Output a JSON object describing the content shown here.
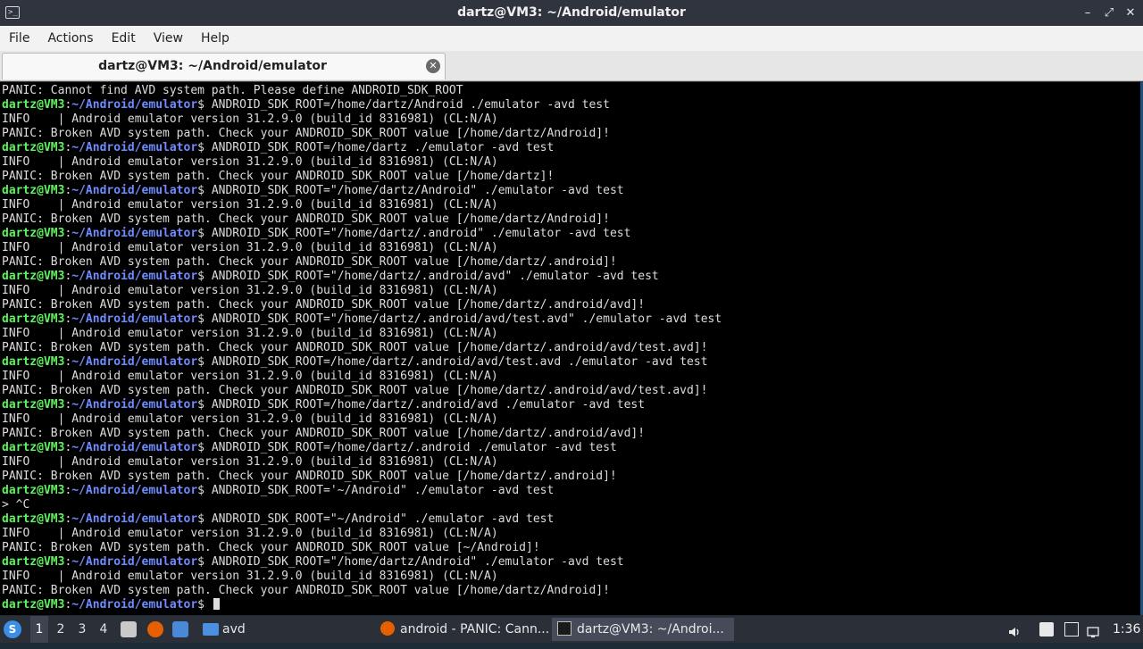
{
  "window": {
    "title": "dartz@VM3: ~/Android/emulator",
    "app_icon_text": ">_",
    "buttons": {
      "minimize": "–",
      "maximize": "⤢",
      "close": "✕"
    }
  },
  "menu": [
    "File",
    "Actions",
    "Edit",
    "View",
    "Help"
  ],
  "tab": {
    "label": "dartz@VM3: ~/Android/emulator",
    "close_glyph": "✕"
  },
  "prompt": {
    "user": "dartz@VM3",
    "path": "~/Android/emulator"
  },
  "terminal_lines": [
    {
      "type": "out",
      "text": "PANIC: Cannot find AVD system path. Please define ANDROID_SDK_ROOT"
    },
    {
      "type": "cmd",
      "text": "ANDROID_SDK_ROOT=/home/dartz/Android ./emulator -avd test"
    },
    {
      "type": "out",
      "text": "INFO    | Android emulator version 31.2.9.0 (build_id 8316981) (CL:N/A)"
    },
    {
      "type": "out",
      "text": "PANIC: Broken AVD system path. Check your ANDROID_SDK_ROOT value [/home/dartz/Android]!"
    },
    {
      "type": "cmd",
      "text": "ANDROID_SDK_ROOT=/home/dartz ./emulator -avd test"
    },
    {
      "type": "out",
      "text": "INFO    | Android emulator version 31.2.9.0 (build_id 8316981) (CL:N/A)"
    },
    {
      "type": "out",
      "text": "PANIC: Broken AVD system path. Check your ANDROID_SDK_ROOT value [/home/dartz]!"
    },
    {
      "type": "cmd",
      "text": "ANDROID_SDK_ROOT=\"/home/dartz/Android\" ./emulator -avd test"
    },
    {
      "type": "out",
      "text": "INFO    | Android emulator version 31.2.9.0 (build_id 8316981) (CL:N/A)"
    },
    {
      "type": "out",
      "text": "PANIC: Broken AVD system path. Check your ANDROID_SDK_ROOT value [/home/dartz/Android]!"
    },
    {
      "type": "cmd",
      "text": "ANDROID_SDK_ROOT=\"/home/dartz/.android\" ./emulator -avd test"
    },
    {
      "type": "out",
      "text": "INFO    | Android emulator version 31.2.9.0 (build_id 8316981) (CL:N/A)"
    },
    {
      "type": "out",
      "text": "PANIC: Broken AVD system path. Check your ANDROID_SDK_ROOT value [/home/dartz/.android]!"
    },
    {
      "type": "cmd",
      "text": "ANDROID_SDK_ROOT=\"/home/dartz/.android/avd\" ./emulator -avd test"
    },
    {
      "type": "out",
      "text": "INFO    | Android emulator version 31.2.9.0 (build_id 8316981) (CL:N/A)"
    },
    {
      "type": "out",
      "text": "PANIC: Broken AVD system path. Check your ANDROID_SDK_ROOT value [/home/dartz/.android/avd]!"
    },
    {
      "type": "cmd",
      "text": "ANDROID_SDK_ROOT=\"/home/dartz/.android/avd/test.avd\" ./emulator -avd test"
    },
    {
      "type": "out",
      "text": "INFO    | Android emulator version 31.2.9.0 (build_id 8316981) (CL:N/A)"
    },
    {
      "type": "out",
      "text": "PANIC: Broken AVD system path. Check your ANDROID_SDK_ROOT value [/home/dartz/.android/avd/test.avd]!"
    },
    {
      "type": "cmd",
      "text": "ANDROID_SDK_ROOT=/home/dartz/.android/avd/test.avd ./emulator -avd test"
    },
    {
      "type": "out",
      "text": "INFO    | Android emulator version 31.2.9.0 (build_id 8316981) (CL:N/A)"
    },
    {
      "type": "out",
      "text": "PANIC: Broken AVD system path. Check your ANDROID_SDK_ROOT value [/home/dartz/.android/avd/test.avd]!"
    },
    {
      "type": "cmd",
      "text": "ANDROID_SDK_ROOT=/home/dartz/.android/avd ./emulator -avd test"
    },
    {
      "type": "out",
      "text": "INFO    | Android emulator version 31.2.9.0 (build_id 8316981) (CL:N/A)"
    },
    {
      "type": "out",
      "text": "PANIC: Broken AVD system path. Check your ANDROID_SDK_ROOT value [/home/dartz/.android/avd]!"
    },
    {
      "type": "cmd",
      "text": "ANDROID_SDK_ROOT=/home/dartz/.android ./emulator -avd test"
    },
    {
      "type": "out",
      "text": "INFO    | Android emulator version 31.2.9.0 (build_id 8316981) (CL:N/A)"
    },
    {
      "type": "out",
      "text": "PANIC: Broken AVD system path. Check your ANDROID_SDK_ROOT value [/home/dartz/.android]!"
    },
    {
      "type": "cmd",
      "text": "ANDROID_SDK_ROOT='~/Android\" ./emulator -avd test"
    },
    {
      "type": "out",
      "text": "> ^C"
    },
    {
      "type": "cmd",
      "text": "ANDROID_SDK_ROOT=\"~/Android\" ./emulator -avd test"
    },
    {
      "type": "out",
      "text": "INFO    | Android emulator version 31.2.9.0 (build_id 8316981) (CL:N/A)"
    },
    {
      "type": "out",
      "text": "PANIC: Broken AVD system path. Check your ANDROID_SDK_ROOT value [~/Android]!"
    },
    {
      "type": "cmd",
      "text": "ANDROID_SDK_ROOT=\"/home/dartz/Android\" ./emulator -avd test"
    },
    {
      "type": "out",
      "text": "INFO    | Android emulator version 31.2.9.0 (build_id 8316981) (CL:N/A)"
    },
    {
      "type": "out",
      "text": "PANIC: Broken AVD system path. Check your ANDROID_SDK_ROOT value [/home/dartz/Android]!"
    },
    {
      "type": "cmd",
      "text": "",
      "cursor": true
    }
  ],
  "taskbar": {
    "workspaces": [
      "1",
      "2",
      "3",
      "4"
    ],
    "active_workspace": "1",
    "folder_label": "avd",
    "tasks": [
      {
        "label": "android - PANIC: Cann...",
        "icon": "firefox-icon",
        "active": false
      },
      {
        "label": "dartz@VM3: ~/Androi...",
        "icon": "terminal-icon",
        "active": true
      }
    ],
    "clock": "1:36"
  },
  "colors": {
    "prompt_user": "#5ff25f",
    "prompt_path": "#6f8cff",
    "terminal_bg": "#000000",
    "titlebar_bg": "#2f343f",
    "taskbar_bg": "#2b2f37"
  }
}
